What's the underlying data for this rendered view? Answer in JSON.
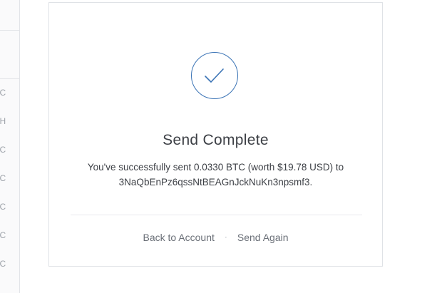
{
  "sidebar": {
    "accounts": [
      {
        "label": "TC"
      },
      {
        "label": "TH"
      },
      {
        "label": "TC"
      },
      {
        "label": "TC"
      },
      {
        "label": "TC"
      },
      {
        "label": "TC"
      },
      {
        "label": "TC"
      }
    ]
  },
  "card": {
    "icon": "checkmark-icon",
    "title": "Send Complete",
    "message_line1": "You've successfully sent 0.0330 BTC (worth $19.78 USD) to",
    "message_line2": "3NaQbEnPz6qssNtBEAGnJckNuKn3npsmf3.",
    "back_label": "Back to Account",
    "separator": "·",
    "send_again_label": "Send Again"
  },
  "colors": {
    "accent": "#3a73b5",
    "text": "#3d4046",
    "link": "#6b7078",
    "border": "#dfe2e6"
  }
}
